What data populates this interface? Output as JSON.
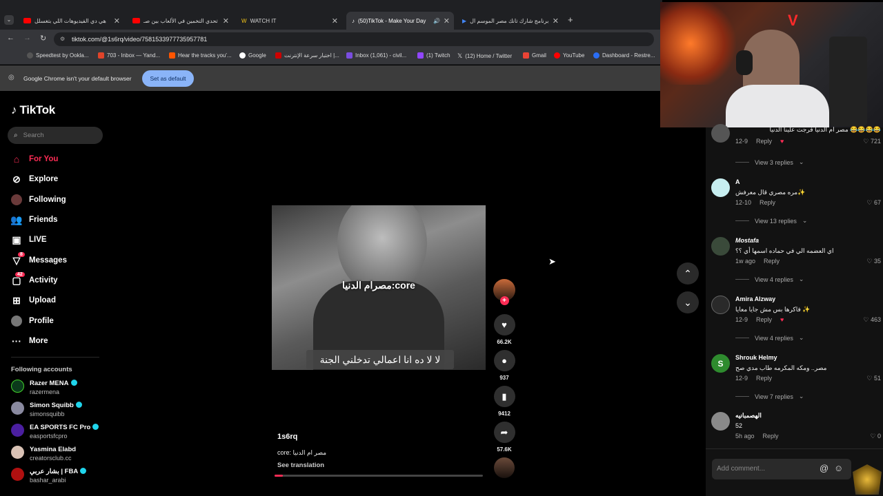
{
  "browser": {
    "tabs": [
      {
        "title": "هي دي الفيديوهات اللي بتغسلل"
      },
      {
        "title": "تحدي التخمين في الألعاب بين صـ"
      },
      {
        "title": "WATCH IT"
      },
      {
        "title": "(50)TikTok - Make Your Day"
      },
      {
        "title": "برنامج شارك تانك مصر الموسم ال"
      }
    ],
    "url": "tiktok.com/@1s6rq/video/7581533977735957781",
    "bookmarks": [
      "Speedtest by Ookla...",
      "703 - Inbox — Yand...",
      "Hear the tracks you'...",
      "Google",
      "اختبار سرعة الإنترنت |...",
      "Inbox (1,061) - civil...",
      "(1) Twitch",
      "(12) Home / Twitter",
      "Gmail",
      "YouTube",
      "Dashboard - Restre..."
    ],
    "infobar_text": "Google Chrome isn't your default browser",
    "set_default_label": "Set as default"
  },
  "sidebar": {
    "logo": "TikTok",
    "search_placeholder": "Search",
    "nav": [
      {
        "label": "For You"
      },
      {
        "label": "Explore"
      },
      {
        "label": "Following"
      },
      {
        "label": "Friends"
      },
      {
        "label": "LIVE"
      },
      {
        "label": "Messages",
        "badge": "8"
      },
      {
        "label": "Activity",
        "badge": "42"
      },
      {
        "label": "Upload"
      },
      {
        "label": "Profile"
      },
      {
        "label": "More"
      }
    ],
    "following_title": "Following accounts",
    "following": [
      {
        "name": "Razer MENA",
        "handle": "razermena"
      },
      {
        "name": "Simon Squibb",
        "handle": "simonsquibb"
      },
      {
        "name": "EA SPORTS FC Pro",
        "handle": "easportsfcpro"
      },
      {
        "name": "Yasmina Elabd",
        "handle": "creatorsclub.cc"
      },
      {
        "name": "بشار عربي | FBA",
        "handle": "bashar_arabi"
      }
    ]
  },
  "video": {
    "overlay_top": "مصرام الدنيا:core",
    "overlay_bottom": "لا لا ده انا اعمالي تدخلني الجنة",
    "author": "1s6rq",
    "caption": "core: مصر ام الدنيا",
    "see_translation": "See translation",
    "likes": "66.2K",
    "comments_count": "937",
    "saves": "9412",
    "shares": "57.6K"
  },
  "comments": [
    {
      "user": "",
      "text": "مصر ام الدنيا فرجت علينا الدنيا 😂😂😂😂",
      "date": "12-9",
      "likes": "721",
      "replies": "View 3 replies"
    },
    {
      "user": "A",
      "text": "مره مصري قال معرفش✨",
      "date": "12-10",
      "likes": "67",
      "replies": "View 13 replies"
    },
    {
      "user": "Mostafa",
      "text": "اي العضمه الي في حماده اسمها أي ؟؟",
      "date": "1w ago",
      "likes": "35",
      "replies": "View 4 replies"
    },
    {
      "user": "Amira Alzway",
      "text": "فاكرها بس مش جايا معايا ✨",
      "date": "12-9",
      "likes": "463",
      "replies": "View 4 replies"
    },
    {
      "user": "Shrouk Helmy",
      "text": "مصر.. ومكه المكرمه طاب مدي صح",
      "date": "12-9",
      "likes": "51",
      "replies": "View 7 replies"
    },
    {
      "user": "الهصمبانيه",
      "text": "52",
      "date": "5h ago",
      "likes": "0",
      "replies": ""
    }
  ],
  "reply_label": "Reply",
  "add_comment_placeholder": "Add comment...",
  "colors": {
    "accent": "#fe2c55",
    "verified": "#20d5ec",
    "infobar_button": "#8ab4f8"
  }
}
